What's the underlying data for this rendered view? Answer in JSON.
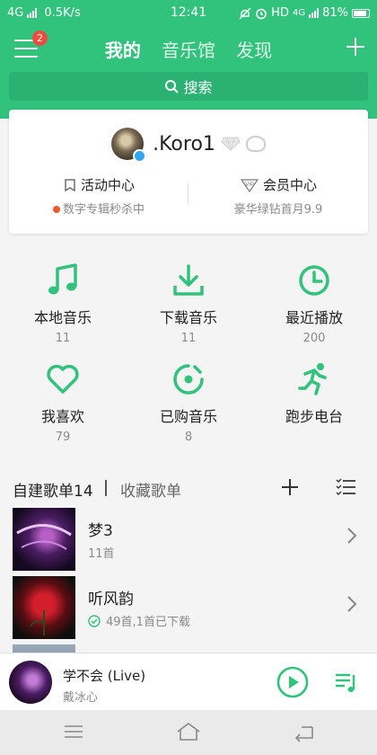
{
  "status_bar": {
    "network_left": "4G",
    "speed": "0.5K/s",
    "time": "12:41",
    "hd": "HD",
    "network_right": "4G",
    "battery": "81%"
  },
  "header": {
    "menu_badge": "2",
    "tabs": [
      "我的",
      "音乐馆",
      "发现"
    ],
    "search_label": "搜索"
  },
  "profile": {
    "username": ".Koro1",
    "activity_title": "活动中心",
    "activity_sub": "数字专辑秒杀中",
    "vip_title": "会员中心",
    "vip_sub": "豪华绿钻首月9.9",
    "vip_tag": "VIP"
  },
  "grid": [
    {
      "label": "本地音乐",
      "count": "11",
      "icon": "music-note-icon"
    },
    {
      "label": "下载音乐",
      "count": "11",
      "icon": "download-icon"
    },
    {
      "label": "最近播放",
      "count": "200",
      "icon": "clock-icon"
    },
    {
      "label": "我喜欢",
      "count": "79",
      "icon": "heart-icon"
    },
    {
      "label": "已购音乐",
      "count": "8",
      "icon": "purchased-disc-icon"
    },
    {
      "label": "跑步电台",
      "count": "",
      "icon": "runner-icon"
    }
  ],
  "playlists_header": {
    "own_label": "自建歌单14",
    "collected_label": "收藏歌单"
  },
  "playlists": [
    {
      "name": "梦3",
      "meta": "11首",
      "downloaded": false
    },
    {
      "name": "听风韵",
      "meta": "49首,1首已下载",
      "downloaded": true
    }
  ],
  "now_playing": {
    "title": "学不会 (Live)",
    "artist": "戴冰心"
  },
  "colors": {
    "accent": "#31c27c",
    "badge": "#f04a3e"
  }
}
